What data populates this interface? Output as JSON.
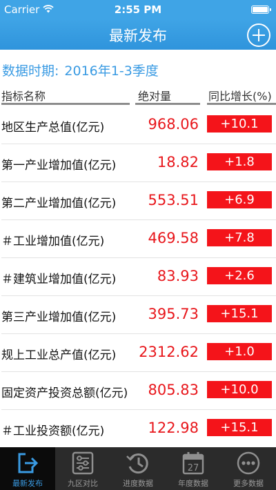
{
  "status_bar": {
    "carrier": "Carrier",
    "time": "2:55 PM"
  },
  "nav": {
    "title": "最新发布"
  },
  "period": {
    "label": "数据时期:",
    "value": "2016年1-3季度"
  },
  "columns": {
    "name": "指标名称",
    "absolute": "绝对量",
    "yoy": "同比增长(%)"
  },
  "rows": [
    {
      "name": "地区生产总值(亿元)",
      "value": "968.06",
      "yoy": "+10.1"
    },
    {
      "name": "第一产业增加值(亿元)",
      "value": "18.82",
      "yoy": "+1.8"
    },
    {
      "name": "第二产业增加值(亿元)",
      "value": "553.51",
      "yoy": "+6.9"
    },
    {
      "name": "＃工业增加值(亿元)",
      "value": "469.58",
      "yoy": "+7.8"
    },
    {
      "name": "＃建筑业增加值(亿元)",
      "value": "83.93",
      "yoy": "+2.6"
    },
    {
      "name": "第三产业增加值(亿元)",
      "value": "395.73",
      "yoy": "+15.1"
    },
    {
      "name": "规上工业总产值(亿元)",
      "value": "2312.62",
      "yoy": "+1.0"
    },
    {
      "name": "固定资产投资总额(亿元)",
      "value": "805.83",
      "yoy": "+10.0"
    },
    {
      "name": "＃工业投资额(亿元)",
      "value": "122.98",
      "yoy": "+15.1"
    }
  ],
  "tabs": [
    {
      "label": "最新发布",
      "icon": "export-icon",
      "active": true,
      "badge": ""
    },
    {
      "label": "九区对比",
      "icon": "sliders-icon",
      "active": false,
      "badge": ""
    },
    {
      "label": "进度数据",
      "icon": "history-clock-icon",
      "active": false,
      "badge": ""
    },
    {
      "label": "年度数据",
      "icon": "calendar-icon",
      "active": false,
      "badge": "27"
    },
    {
      "label": "更多数据",
      "icon": "more-icon",
      "active": false,
      "badge": ""
    }
  ],
  "colors": {
    "accent": "#3a9be3",
    "nav_bar": "#3fa4e6",
    "value_red": "#e8161b",
    "badge_red": "#f4141a",
    "tab_bar": "#2b2b2b"
  }
}
